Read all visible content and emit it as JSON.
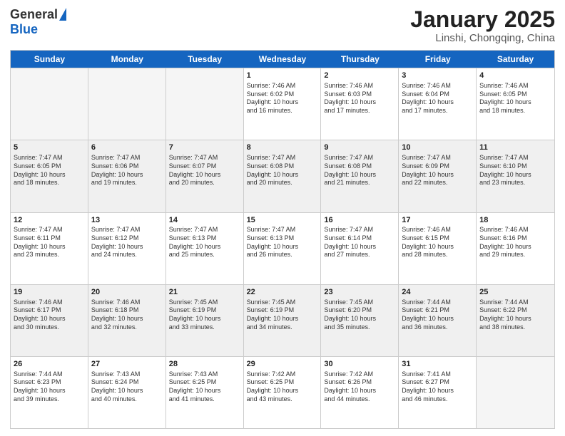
{
  "logo": {
    "general": "General",
    "blue": "Blue"
  },
  "title": "January 2025",
  "subtitle": "Linshi, Chongqing, China",
  "days": [
    "Sunday",
    "Monday",
    "Tuesday",
    "Wednesday",
    "Thursday",
    "Friday",
    "Saturday"
  ],
  "weeks": [
    [
      {
        "day": "",
        "empty": true
      },
      {
        "day": "",
        "empty": true
      },
      {
        "day": "",
        "empty": true
      },
      {
        "day": "1",
        "info": "Sunrise: 7:46 AM\nSunset: 6:02 PM\nDaylight: 10 hours\nand 16 minutes."
      },
      {
        "day": "2",
        "info": "Sunrise: 7:46 AM\nSunset: 6:03 PM\nDaylight: 10 hours\nand 17 minutes."
      },
      {
        "day": "3",
        "info": "Sunrise: 7:46 AM\nSunset: 6:04 PM\nDaylight: 10 hours\nand 17 minutes."
      },
      {
        "day": "4",
        "info": "Sunrise: 7:46 AM\nSunset: 6:05 PM\nDaylight: 10 hours\nand 18 minutes."
      }
    ],
    [
      {
        "day": "5",
        "info": "Sunrise: 7:47 AM\nSunset: 6:05 PM\nDaylight: 10 hours\nand 18 minutes."
      },
      {
        "day": "6",
        "info": "Sunrise: 7:47 AM\nSunset: 6:06 PM\nDaylight: 10 hours\nand 19 minutes."
      },
      {
        "day": "7",
        "info": "Sunrise: 7:47 AM\nSunset: 6:07 PM\nDaylight: 10 hours\nand 20 minutes."
      },
      {
        "day": "8",
        "info": "Sunrise: 7:47 AM\nSunset: 6:08 PM\nDaylight: 10 hours\nand 20 minutes."
      },
      {
        "day": "9",
        "info": "Sunrise: 7:47 AM\nSunset: 6:08 PM\nDaylight: 10 hours\nand 21 minutes."
      },
      {
        "day": "10",
        "info": "Sunrise: 7:47 AM\nSunset: 6:09 PM\nDaylight: 10 hours\nand 22 minutes."
      },
      {
        "day": "11",
        "info": "Sunrise: 7:47 AM\nSunset: 6:10 PM\nDaylight: 10 hours\nand 23 minutes."
      }
    ],
    [
      {
        "day": "12",
        "info": "Sunrise: 7:47 AM\nSunset: 6:11 PM\nDaylight: 10 hours\nand 23 minutes."
      },
      {
        "day": "13",
        "info": "Sunrise: 7:47 AM\nSunset: 6:12 PM\nDaylight: 10 hours\nand 24 minutes."
      },
      {
        "day": "14",
        "info": "Sunrise: 7:47 AM\nSunset: 6:13 PM\nDaylight: 10 hours\nand 25 minutes."
      },
      {
        "day": "15",
        "info": "Sunrise: 7:47 AM\nSunset: 6:13 PM\nDaylight: 10 hours\nand 26 minutes."
      },
      {
        "day": "16",
        "info": "Sunrise: 7:47 AM\nSunset: 6:14 PM\nDaylight: 10 hours\nand 27 minutes."
      },
      {
        "day": "17",
        "info": "Sunrise: 7:46 AM\nSunset: 6:15 PM\nDaylight: 10 hours\nand 28 minutes."
      },
      {
        "day": "18",
        "info": "Sunrise: 7:46 AM\nSunset: 6:16 PM\nDaylight: 10 hours\nand 29 minutes."
      }
    ],
    [
      {
        "day": "19",
        "info": "Sunrise: 7:46 AM\nSunset: 6:17 PM\nDaylight: 10 hours\nand 30 minutes."
      },
      {
        "day": "20",
        "info": "Sunrise: 7:46 AM\nSunset: 6:18 PM\nDaylight: 10 hours\nand 32 minutes."
      },
      {
        "day": "21",
        "info": "Sunrise: 7:45 AM\nSunset: 6:19 PM\nDaylight: 10 hours\nand 33 minutes."
      },
      {
        "day": "22",
        "info": "Sunrise: 7:45 AM\nSunset: 6:19 PM\nDaylight: 10 hours\nand 34 minutes."
      },
      {
        "day": "23",
        "info": "Sunrise: 7:45 AM\nSunset: 6:20 PM\nDaylight: 10 hours\nand 35 minutes."
      },
      {
        "day": "24",
        "info": "Sunrise: 7:44 AM\nSunset: 6:21 PM\nDaylight: 10 hours\nand 36 minutes."
      },
      {
        "day": "25",
        "info": "Sunrise: 7:44 AM\nSunset: 6:22 PM\nDaylight: 10 hours\nand 38 minutes."
      }
    ],
    [
      {
        "day": "26",
        "info": "Sunrise: 7:44 AM\nSunset: 6:23 PM\nDaylight: 10 hours\nand 39 minutes."
      },
      {
        "day": "27",
        "info": "Sunrise: 7:43 AM\nSunset: 6:24 PM\nDaylight: 10 hours\nand 40 minutes."
      },
      {
        "day": "28",
        "info": "Sunrise: 7:43 AM\nSunset: 6:25 PM\nDaylight: 10 hours\nand 41 minutes."
      },
      {
        "day": "29",
        "info": "Sunrise: 7:42 AM\nSunset: 6:25 PM\nDaylight: 10 hours\nand 43 minutes."
      },
      {
        "day": "30",
        "info": "Sunrise: 7:42 AM\nSunset: 6:26 PM\nDaylight: 10 hours\nand 44 minutes."
      },
      {
        "day": "31",
        "info": "Sunrise: 7:41 AM\nSunset: 6:27 PM\nDaylight: 10 hours\nand 46 minutes."
      },
      {
        "day": "",
        "empty": true
      }
    ]
  ]
}
